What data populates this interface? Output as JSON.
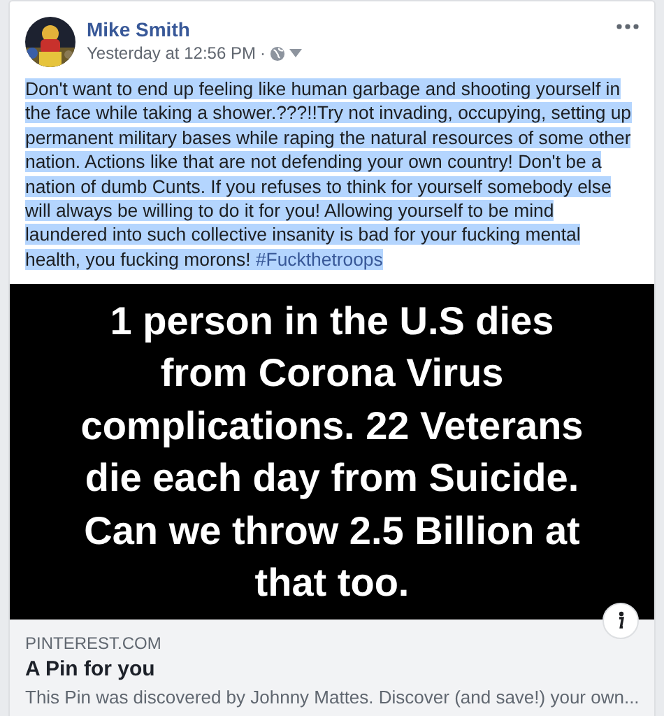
{
  "post": {
    "author": "Mike Smith",
    "timestamp": "Yesterday at 12:56 PM",
    "separator": "·",
    "text": "Don't want to end up feeling like human garbage and shooting yourself in the face while taking a shower.???!!Try not invading, occupying, setting up permanent military bases while raping the natural resources of some other nation. Actions like that are not defending your own country! Don't be a nation of dumb Cunts. If you refuses to think for yourself somebody else will always be willing to do it for you! Allowing yourself to be mind laundered into such collective insanity is bad for your fucking mental health, you fucking morons!",
    "hashtag": "#Fuckthetroops",
    "highlighted": true
  },
  "link_preview": {
    "image_lines": [
      "1 person in the U.S dies",
      "from Corona Virus",
      "complications. 22 Veterans",
      "die each day from Suicide.",
      "Can we throw 2.5 Billion at",
      "that too."
    ],
    "domain": "PINTEREST.COM",
    "title": "A Pin for you",
    "description": "This Pin was discovered by Johnny Mattes. Discover (and save!) your own..."
  }
}
